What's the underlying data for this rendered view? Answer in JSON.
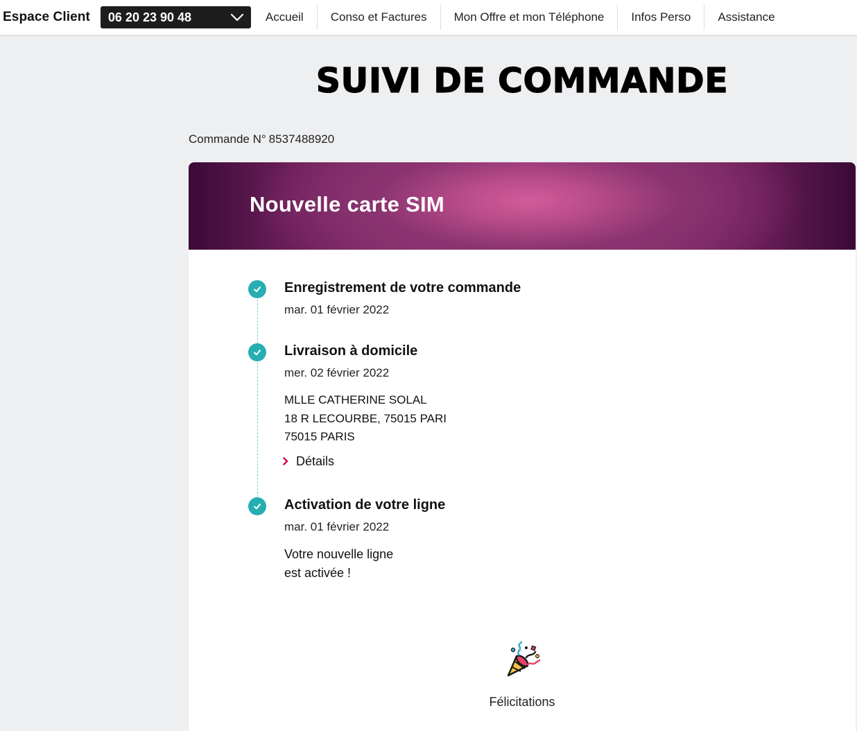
{
  "header": {
    "brand": "Espace Client",
    "line_number": "06 20 23 90 48",
    "nav": [
      "Accueil",
      "Conso et Factures",
      "Mon Offre et mon Téléphone",
      "Infos Perso",
      "Assistance"
    ]
  },
  "page": {
    "title": "SUIVI DE COMMANDE",
    "order_label": "Commande N°",
    "order_number": "8537488920"
  },
  "card": {
    "title": "Nouvelle carte SIM",
    "steps": [
      {
        "title": "Enregistrement de votre commande",
        "date": "mar. 01 février 2022",
        "status": "done"
      },
      {
        "title": "Livraison à domicile",
        "date": "mer. 02 février 2022",
        "status": "done",
        "address": [
          "MLLE CATHERINE SOLAL",
          "18 R LECOURBE, 75015 PARI",
          "75015 PARIS"
        ],
        "details_label": "Détails"
      },
      {
        "title": "Activation de votre ligne",
        "date": "mar. 01 février 2022",
        "status": "done",
        "message": [
          "Votre nouvelle ligne",
          "est activée !"
        ]
      }
    ],
    "congrats": {
      "icon": "party-popper-icon",
      "text": "Félicitations"
    }
  },
  "colors": {
    "accent_teal": "#26aeb3",
    "chevron_red": "#d1004b",
    "header_magenta": "#d35b9c",
    "header_dark": "#3a0a36"
  }
}
